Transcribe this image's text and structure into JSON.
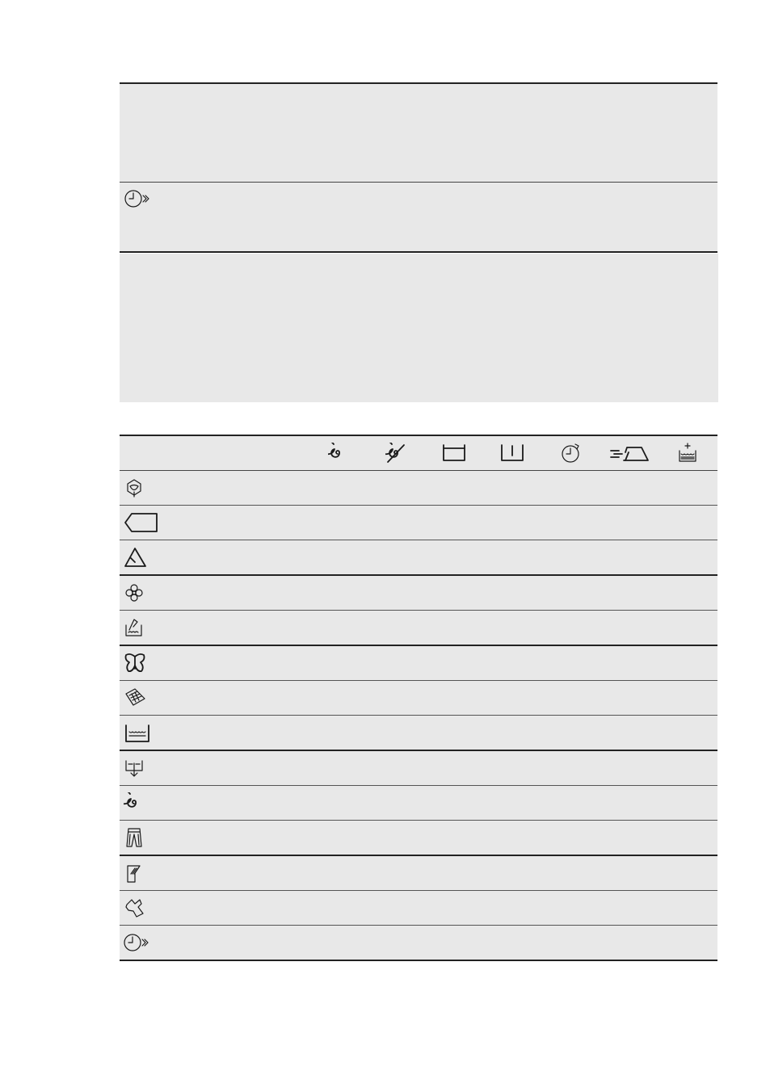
{
  "upper_table": {
    "rows": [
      {
        "icon": "blank"
      },
      {
        "icon": "time-save-icon"
      }
    ]
  },
  "options_table": {
    "columns": [
      {
        "icon": "spin-icon"
      },
      {
        "icon": "no-spin-icon"
      },
      {
        "icon": "rinse-hold-icon"
      },
      {
        "icon": "night-cycle-icon"
      },
      {
        "icon": "delay-start-icon"
      },
      {
        "icon": "easy-iron-icon"
      },
      {
        "icon": "extra-rinse-icon"
      }
    ],
    "programmes": [
      {
        "icon": "eco-icon"
      },
      {
        "icon": "cottons-icon"
      },
      {
        "icon": "synthetics-icon"
      },
      {
        "icon": "delicates-icon"
      },
      {
        "icon": "wool-handwash-icon"
      },
      {
        "icon": "silk-icon"
      },
      {
        "icon": "duvet-icon"
      },
      {
        "icon": "rinse-icon"
      },
      {
        "icon": "drain-icon"
      },
      {
        "icon": "spin-icon"
      },
      {
        "icon": "denim-icon"
      },
      {
        "icon": "sport-icon"
      },
      {
        "icon": "anti-allergy-icon"
      },
      {
        "icon": "time-save-icon"
      }
    ]
  }
}
